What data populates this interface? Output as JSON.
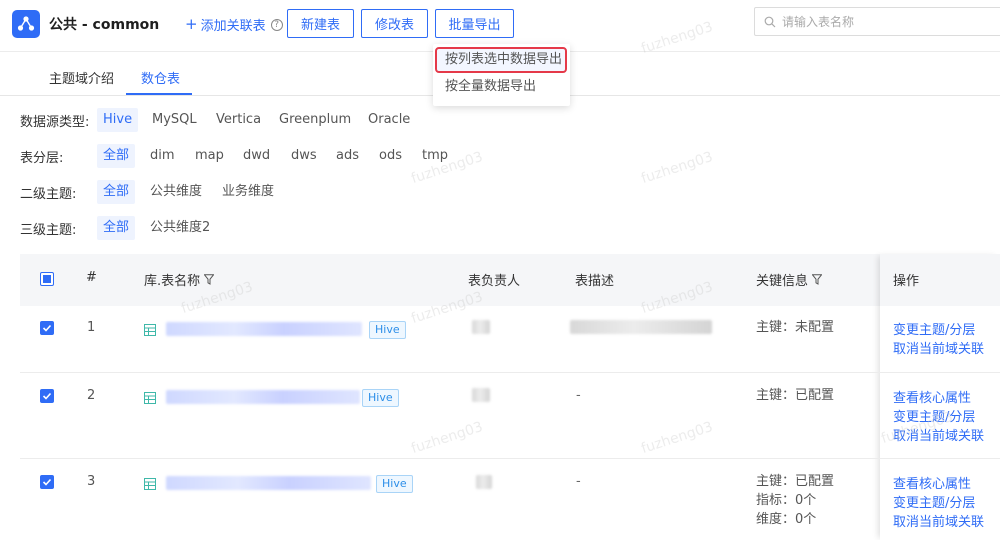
{
  "header": {
    "title": "公共 - common",
    "add_link": "添加关联表",
    "buttons": {
      "new": "新建表",
      "edit": "修改表",
      "batch_export": "批量导出"
    },
    "search_placeholder": "请输入表名称"
  },
  "dropdown": {
    "items": [
      "按列表选中数据导出",
      "按全量数据导出"
    ]
  },
  "tabs": [
    "主题域介绍",
    "数仓表"
  ],
  "filters": {
    "source": {
      "label": "数据源类型:",
      "options": [
        "Hive",
        "MySQL",
        "Vertica",
        "Greenplum",
        "Oracle"
      ]
    },
    "layer": {
      "label": "表分层:",
      "options": [
        "全部",
        "dim",
        "map",
        "dwd",
        "dws",
        "ads",
        "ods",
        "tmp"
      ]
    },
    "topic2": {
      "label": "二级主题:",
      "options": [
        "全部",
        "公共维度",
        "业务维度"
      ]
    },
    "topic3": {
      "label": "三级主题:",
      "options": [
        "全部",
        "公共维度2"
      ]
    }
  },
  "table": {
    "headers": {
      "index": "#",
      "name": "库.表名称",
      "owner": "表负责人",
      "desc": "表描述",
      "key": "关键信息",
      "ops": "操作"
    },
    "rows": [
      {
        "index": "1",
        "tag": "Hive",
        "desc": "",
        "key_lines": [
          "主键：未配置"
        ],
        "ops": [
          "变更主题/分层",
          "取消当前域关联"
        ]
      },
      {
        "index": "2",
        "tag": "Hive",
        "desc": "-",
        "key_lines": [
          "主键：已配置"
        ],
        "ops": [
          "查看核心属性",
          "变更主题/分层",
          "取消当前域关联"
        ]
      },
      {
        "index": "3",
        "tag": "Hive",
        "desc": "-",
        "key_lines": [
          "主键：已配置",
          "指标：0个",
          "维度：0个"
        ],
        "ops": [
          "查看核心属性",
          "变更主题/分层",
          "取消当前域关联"
        ]
      }
    ]
  },
  "watermark": "fuzheng03",
  "colors": {
    "accent": "#2f6cf6",
    "highlight_border": "#e53949"
  }
}
